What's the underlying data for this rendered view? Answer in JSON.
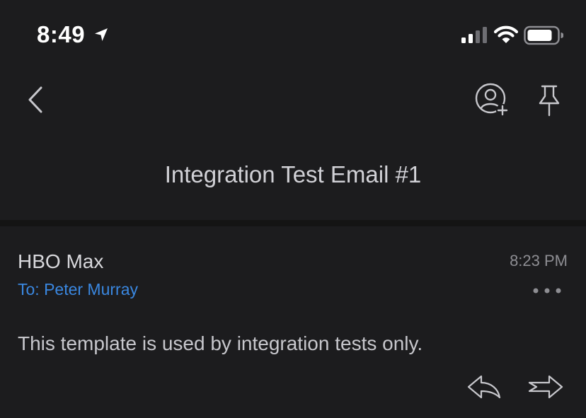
{
  "status_bar": {
    "time": "8:49",
    "icons": [
      "location-arrow-icon",
      "cellular-signal-icon",
      "wifi-icon",
      "battery-icon"
    ]
  },
  "nav": {
    "back_icon": "chevron-left-icon",
    "actions": [
      "add-contact-icon",
      "pin-icon"
    ]
  },
  "email": {
    "subject": "Integration Test Email #1",
    "sender": "HBO Max",
    "recipient": "To: Peter Murray",
    "timestamp": "8:23 PM",
    "body": "This template is used by integration tests only.",
    "message_actions": [
      "more-icon",
      "reply-icon",
      "forward-icon"
    ]
  },
  "colors": {
    "background": "#1c1c1e",
    "divider": "#141414",
    "accent": "#3a87e0",
    "icon": "#c7c7cc",
    "secondary_text": "#8e8e93"
  }
}
